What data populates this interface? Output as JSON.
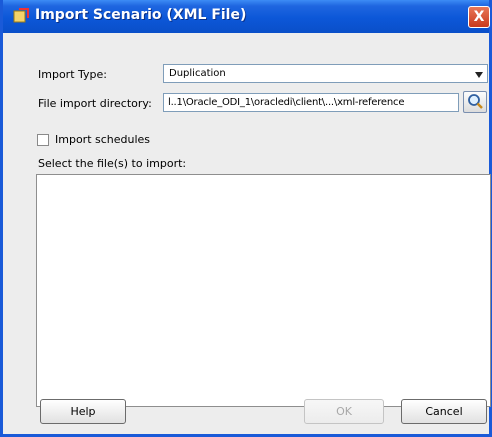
{
  "window": {
    "title": "Import Scenario (XML File)",
    "close_glyph": "X",
    "icon": "import-icon"
  },
  "form": {
    "import_type_label": "Import Type:",
    "import_type_value": "Duplication",
    "dir_label": "File import directory:",
    "dir_value": "l..1\\Oracle_ODI_1\\oracledi\\client\\...\\xml-reference",
    "import_schedules_label": "Import schedules",
    "import_schedules_checked": false,
    "files_label": "Select the file(s) to import:"
  },
  "buttons": {
    "help": "Help",
    "ok": "OK",
    "cancel": "Cancel"
  },
  "colors": {
    "titlebar": "#0c57d8",
    "accent_close": "#c8391d"
  }
}
